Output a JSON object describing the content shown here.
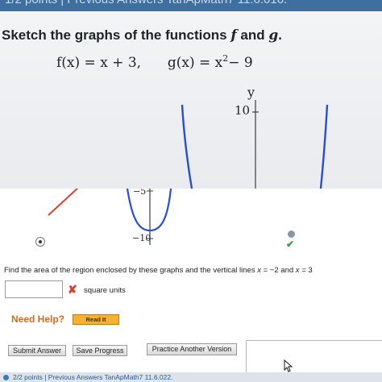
{
  "header": {
    "top_strip_text": "1/2 points  |  Previous Answers   TanApMath7 11.6.016."
  },
  "problem": {
    "prompt_prefix": "Sketch the graphs of the functions",
    "prompt_f": "f",
    "prompt_and": "and",
    "prompt_g": "g",
    "prompt_end": ".",
    "f_def": "f(x) = x + 3,",
    "g_def_prefix": "g(x) = x",
    "g_def_exp": "2",
    "g_def_suffix": " − 9"
  },
  "graph": {
    "y_axis_label": "y",
    "tick_top": "10",
    "tick_mid": "−5",
    "tick_bottom": "−10"
  },
  "question": {
    "text_prefix": "Find the area of the region enclosed by these graphs and the vertical lines",
    "x_var_1": "x",
    "eq_1": "= −2",
    "and_word": "and",
    "x_var_2": "x",
    "eq_2": "= 3"
  },
  "answer": {
    "value": "",
    "status_icon": "x-mark-icon",
    "units": "square units"
  },
  "help": {
    "label": "Need Help?",
    "read_it": "Read It"
  },
  "actions": {
    "submit": "Submit Answer",
    "save": "Save Progress",
    "practice": "Practice Another Version"
  },
  "footer": {
    "text": "2/2 points  |  Previous Answers   TanApMath7 11.6.022."
  },
  "colors": {
    "curve_blue": "#2b4fc4",
    "line_red": "#d7442f",
    "wrong_red": "#d83b2e",
    "check_green": "#3a9a3a",
    "read_it_orange": "#f3b232",
    "need_help_orange": "#d06a1d"
  }
}
